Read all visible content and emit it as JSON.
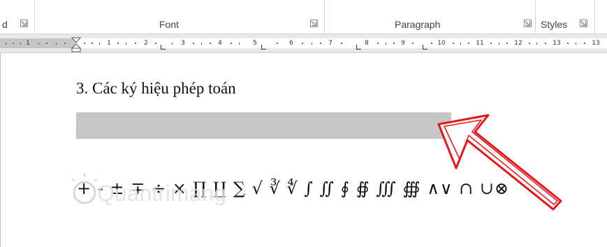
{
  "ribbon": {
    "groups": [
      {
        "label": "d"
      },
      {
        "label": "Font"
      },
      {
        "label": "Paragraph"
      },
      {
        "label": "Styles"
      }
    ]
  },
  "ruler": {
    "numbers": [
      "1",
      "1",
      "2",
      "3",
      "4",
      "5",
      "6",
      "7",
      "8",
      "9",
      "10",
      "11",
      "12",
      "13"
    ]
  },
  "document": {
    "heading": "3. Các ký hiệu phép toán",
    "symbols": "+ - ± ∓ ÷  ×  ∏ ∐ ∑ √ ∛ ∜ ∫ ∬ ∮ ∯ ∭ ∰ ∧∨ ∩ ∪⊗"
  },
  "watermark": {
    "text": "Quantrimang"
  },
  "colors": {
    "highlight": "#c6c6c6",
    "arrow": "#e8141a"
  }
}
